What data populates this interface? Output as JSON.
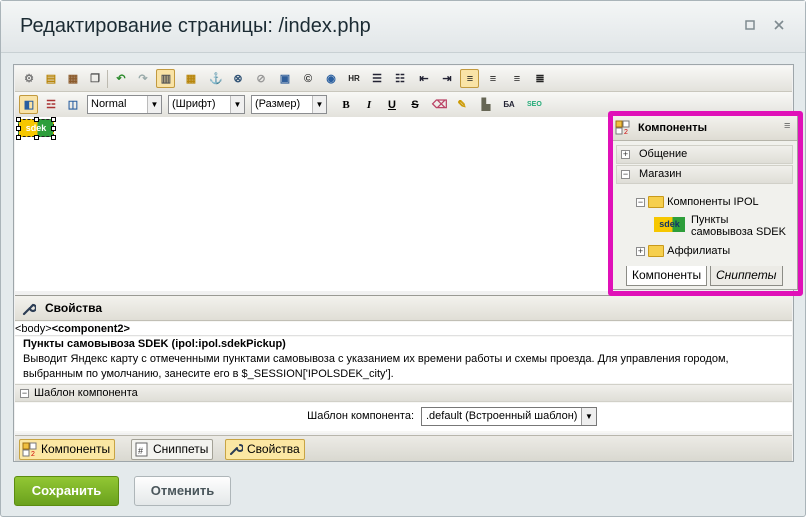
{
  "window": {
    "title": "Редактирование страницы: /index.php",
    "minimize_icon": "square-icon",
    "close_icon": "close-icon"
  },
  "toolbar1": {
    "icons": [
      "settings-icon",
      "page-properties-icon",
      "template-icon",
      "copy-icon",
      "undo-icon",
      "redo-icon",
      "table-border-icon",
      "table-icon",
      "anchor-icon",
      "link-icon",
      "unlink-icon",
      "image-icon",
      "copyright-icon",
      "flash-icon",
      "hr-icon",
      "ordered-list-icon",
      "unordered-list-icon",
      "outdent-icon",
      "indent-icon",
      "align-left-icon",
      "align-center-icon",
      "align-right-icon",
      "justify-icon"
    ]
  },
  "toolbar2": {
    "format_value": "Normal",
    "font_value": "(Шрифт)",
    "size_value": "(Размер)",
    "bold": "B",
    "italic": "I",
    "underline": "U",
    "strike": "S"
  },
  "content": {
    "component_tag": "sdek"
  },
  "taskbar": {
    "title": "Компоненты",
    "category1": "Общение",
    "category2": "Магазин",
    "folder1": "Компоненты IPOL",
    "item1_line1": "Пункты",
    "item1_line2": "самовывоза SDEK",
    "item_icon_text": "sdek",
    "folder2": "Аффилиаты",
    "tab1": "Компоненты",
    "tab2": "Сниппеты"
  },
  "props": {
    "title": "Свойства",
    "breadcrumb_prefix": "<body>",
    "breadcrumb_tag": "<component2>",
    "component_name": "Пункты самовывоза SDEK (ipol:ipol.sdekPickup)",
    "description_line1": "Выводит Яндекс карту с отмеченными пунктами самовывоза с указанием их времени работы и схемы проезда. Для управления городом,",
    "description_line2": "выбранным по умолчанию, занесите его в $_SESSION['IPOLSDEK_city'].",
    "section_title": "Шаблон компонента",
    "field_label": "Шаблон компонента:",
    "field_value": ".default (Встроенный шаблон)"
  },
  "bottom_tabs": {
    "components": "Компоненты",
    "snippets": "Сниппеты",
    "properties": "Свойства"
  },
  "buttons": {
    "save": "Сохранить",
    "cancel": "Отменить"
  },
  "colors": {
    "highlight": "#e011b8",
    "save_green": "#7fb526"
  }
}
